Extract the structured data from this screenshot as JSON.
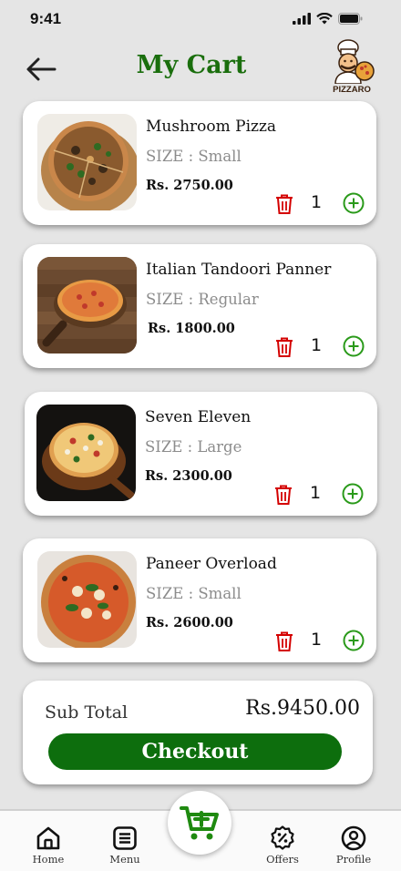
{
  "status": {
    "time": "9:41"
  },
  "header": {
    "title": "My Cart",
    "brand": "PIZZARO"
  },
  "cart_items": [
    {
      "name": "Mushroom Pizza",
      "size": "SIZE : Small",
      "price": "Rs. 2750.00",
      "qty": "1"
    },
    {
      "name": "Italian Tandoori Panner",
      "size": "SIZE : Regular",
      "price": "Rs. 1800.00",
      "qty": "1"
    },
    {
      "name": "Seven Eleven",
      "size": "SIZE : Large",
      "price": "Rs. 2300.00",
      "qty": "1"
    },
    {
      "name": "Paneer Overload",
      "size": "SIZE : Small",
      "price": "Rs. 2600.00",
      "qty": "1"
    }
  ],
  "summary": {
    "subtotal_label": "Sub Total",
    "subtotal_value": "Rs.9450.00",
    "checkout_label": "Checkout"
  },
  "nav": {
    "home": "Home",
    "menu": "Menu",
    "offers": "Offers",
    "profile": "Profile"
  },
  "icons": {
    "back": "arrow-left-icon",
    "trash": "trash-icon",
    "plus": "plus-circle-icon",
    "add_cart": "cart-add-icon"
  },
  "colors": {
    "brand_green": "#1a6e0d",
    "button_green": "#0d6e0d",
    "trash_red": "#d40000",
    "plus_green": "#2a9a1a"
  }
}
